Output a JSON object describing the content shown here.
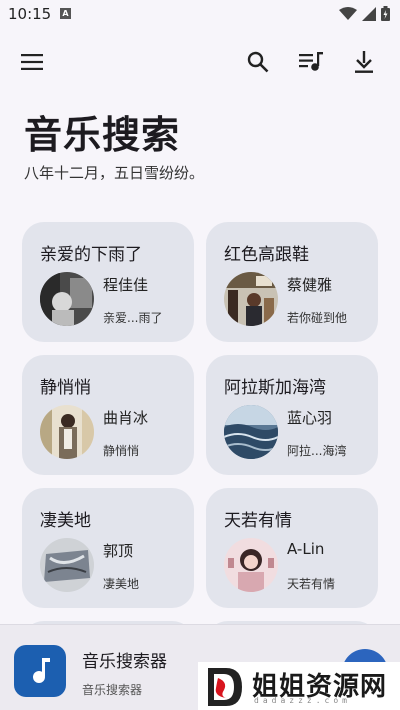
{
  "status_bar": {
    "time": "10:15",
    "icons": [
      "a-notification-icon",
      "wifi-icon",
      "signal-icon",
      "battery-icon"
    ]
  },
  "toolbar": {
    "icons": [
      "menu-icon",
      "search-icon",
      "queue-music-icon",
      "download-icon"
    ]
  },
  "header": {
    "title": "音乐搜索",
    "subtitle": "八年十二月，五日雪纷纷。"
  },
  "cards": [
    {
      "title": "亲爱的下雨了",
      "artist": "程佳佳",
      "sub": "亲爱...雨了"
    },
    {
      "title": "红色高跟鞋",
      "artist": "蔡健雅",
      "sub": "若你碰到他"
    },
    {
      "title": "静悄悄",
      "artist": "曲肖冰",
      "sub": "静悄悄"
    },
    {
      "title": "阿拉斯加海湾",
      "artist": "蓝心羽",
      "sub": "阿拉...海湾"
    },
    {
      "title": "凄美地",
      "artist": "郭顶",
      "sub": "凄美地"
    },
    {
      "title": "天若有情",
      "artist": "A-Lin",
      "sub": "天若有情"
    }
  ],
  "player": {
    "title": "音乐搜索器",
    "subtitle": "音乐搜索器"
  },
  "watermark": {
    "text": "姐姐资源网",
    "sub": "dadazzz.com"
  },
  "colors": {
    "background": "#f7f5fa",
    "card": "#e2e4ec",
    "accent": "#2c65be",
    "player_art": "#1c5fb0"
  }
}
